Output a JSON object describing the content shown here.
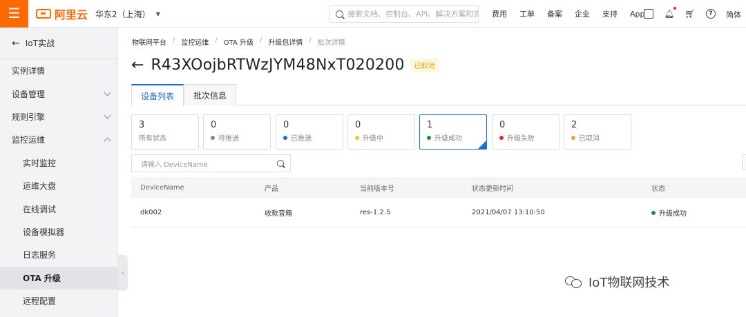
{
  "topbar": {
    "logo_text": "阿里云",
    "region": "华东2（上海）",
    "search_placeholder": "搜索文档、控制台、API、解决方案和资源",
    "links": [
      "费用",
      "工单",
      "备案",
      "企业",
      "支持",
      "App"
    ],
    "lang": "简体",
    "accent_color": "#ff6a00"
  },
  "sidebar": {
    "back_label": "IoT实战",
    "items": [
      {
        "label": "实例详情",
        "sub": false,
        "chevron": ""
      },
      {
        "label": "设备管理",
        "sub": false,
        "chevron": "down"
      },
      {
        "label": "规则引擎",
        "sub": false,
        "chevron": "down"
      },
      {
        "label": "监控运维",
        "sub": false,
        "chevron": "up"
      },
      {
        "label": "实时监控",
        "sub": true,
        "chevron": ""
      },
      {
        "label": "运维大盘",
        "sub": true,
        "chevron": ""
      },
      {
        "label": "在线调试",
        "sub": true,
        "chevron": ""
      },
      {
        "label": "设备模拟器",
        "sub": true,
        "chevron": ""
      },
      {
        "label": "日志服务",
        "sub": true,
        "chevron": ""
      },
      {
        "label": "OTA 升级",
        "sub": true,
        "chevron": "",
        "active": true
      },
      {
        "label": "远程配置",
        "sub": true,
        "chevron": ""
      }
    ]
  },
  "breadcrumb": [
    "物联网平台",
    "监控运维",
    "OTA 升级",
    "升级包详情",
    "批次详情"
  ],
  "page": {
    "title": "R43XOojbRTWzJYM48NxT020200",
    "status_badge": "已取消"
  },
  "tabs": [
    {
      "label": "设备列表",
      "active": true
    },
    {
      "label": "批次信息",
      "active": false
    }
  ],
  "stats": [
    {
      "count": "3",
      "label": "所有状态",
      "color": ""
    },
    {
      "count": "0",
      "label": "待推送",
      "color": "#888888"
    },
    {
      "count": "0",
      "label": "已推送",
      "color": "#1d6ed8"
    },
    {
      "count": "0",
      "label": "升级中",
      "color": "#f5c242"
    },
    {
      "count": "1",
      "label": "升级成功",
      "color": "#1e8e3e",
      "active": true
    },
    {
      "count": "0",
      "label": "升级失败",
      "color": "#d93026"
    },
    {
      "count": "2",
      "label": "已取消",
      "color": "#f0a030"
    }
  ],
  "device_search": {
    "placeholder": "请输入 DeviceName"
  },
  "table": {
    "headers": [
      "DeviceName",
      "产品",
      "当前版本号",
      "状态更新时间",
      "状态"
    ],
    "rows": [
      [
        "dk002",
        "收款音箱",
        "res-1.2.5",
        "2021/04/07 13:10:50",
        "升级成功"
      ]
    ]
  },
  "watermark": "IoT物联网技术"
}
